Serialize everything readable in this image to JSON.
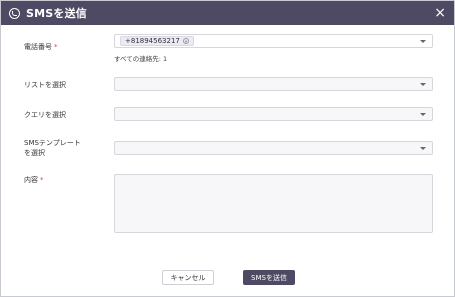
{
  "dialog": {
    "title": "SMSを送信",
    "close_glyph": "×"
  },
  "form": {
    "phone": {
      "label": "電話番号",
      "required_mark": "*",
      "tag_value": "+81894563217",
      "note": "すべての連絡先: 1"
    },
    "list": {
      "label": "リストを選択",
      "value": ""
    },
    "query": {
      "label": "クエリを選択",
      "value": ""
    },
    "template": {
      "label_line1": "SMSテンプレート",
      "label_line2": "を選択",
      "value": ""
    },
    "content": {
      "label": "内容",
      "required_mark": "*",
      "value": ""
    }
  },
  "footer": {
    "cancel_label": "キャンセル",
    "send_label": "SMSを送信"
  },
  "colors": {
    "title_bar": "#4f4a63",
    "required": "#d9443c",
    "primary_button": "#4f4a63"
  }
}
